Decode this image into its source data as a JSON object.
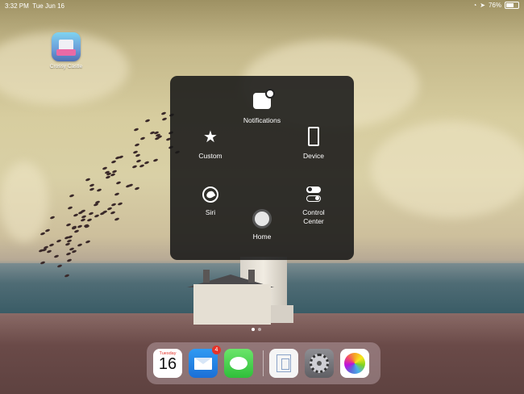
{
  "status_bar": {
    "time": "3:32 PM",
    "date": "Tue Jun 16",
    "battery": "76%",
    "battery_level": 0.76
  },
  "home_screen": {
    "app": {
      "label": "Crossy Castle",
      "icon": "crossy-castle-app-icon"
    }
  },
  "assistive_touch_menu": {
    "items": [
      {
        "label": "Notifications",
        "icon": "notifications-icon"
      },
      {
        "label": "Custom",
        "icon": "star-icon"
      },
      {
        "label": "Device",
        "icon": "ipad-icon"
      },
      {
        "label": "Siri",
        "icon": "siri-icon"
      },
      {
        "label": "Control Center",
        "icon": "control-center-icon"
      },
      {
        "label": "Home",
        "icon": "home-button-icon"
      }
    ]
  },
  "dock": {
    "apps": [
      {
        "name": "calendar",
        "weekday": "Tuesday",
        "date": "16"
      },
      {
        "name": "mail",
        "badge": "4"
      },
      {
        "name": "messages"
      },
      {
        "name": "split-view"
      },
      {
        "name": "settings"
      },
      {
        "name": "photos"
      }
    ]
  },
  "colors": {
    "menu_background": "#181818",
    "badge": "#e5332a",
    "calendar_red": "#e5332a"
  }
}
